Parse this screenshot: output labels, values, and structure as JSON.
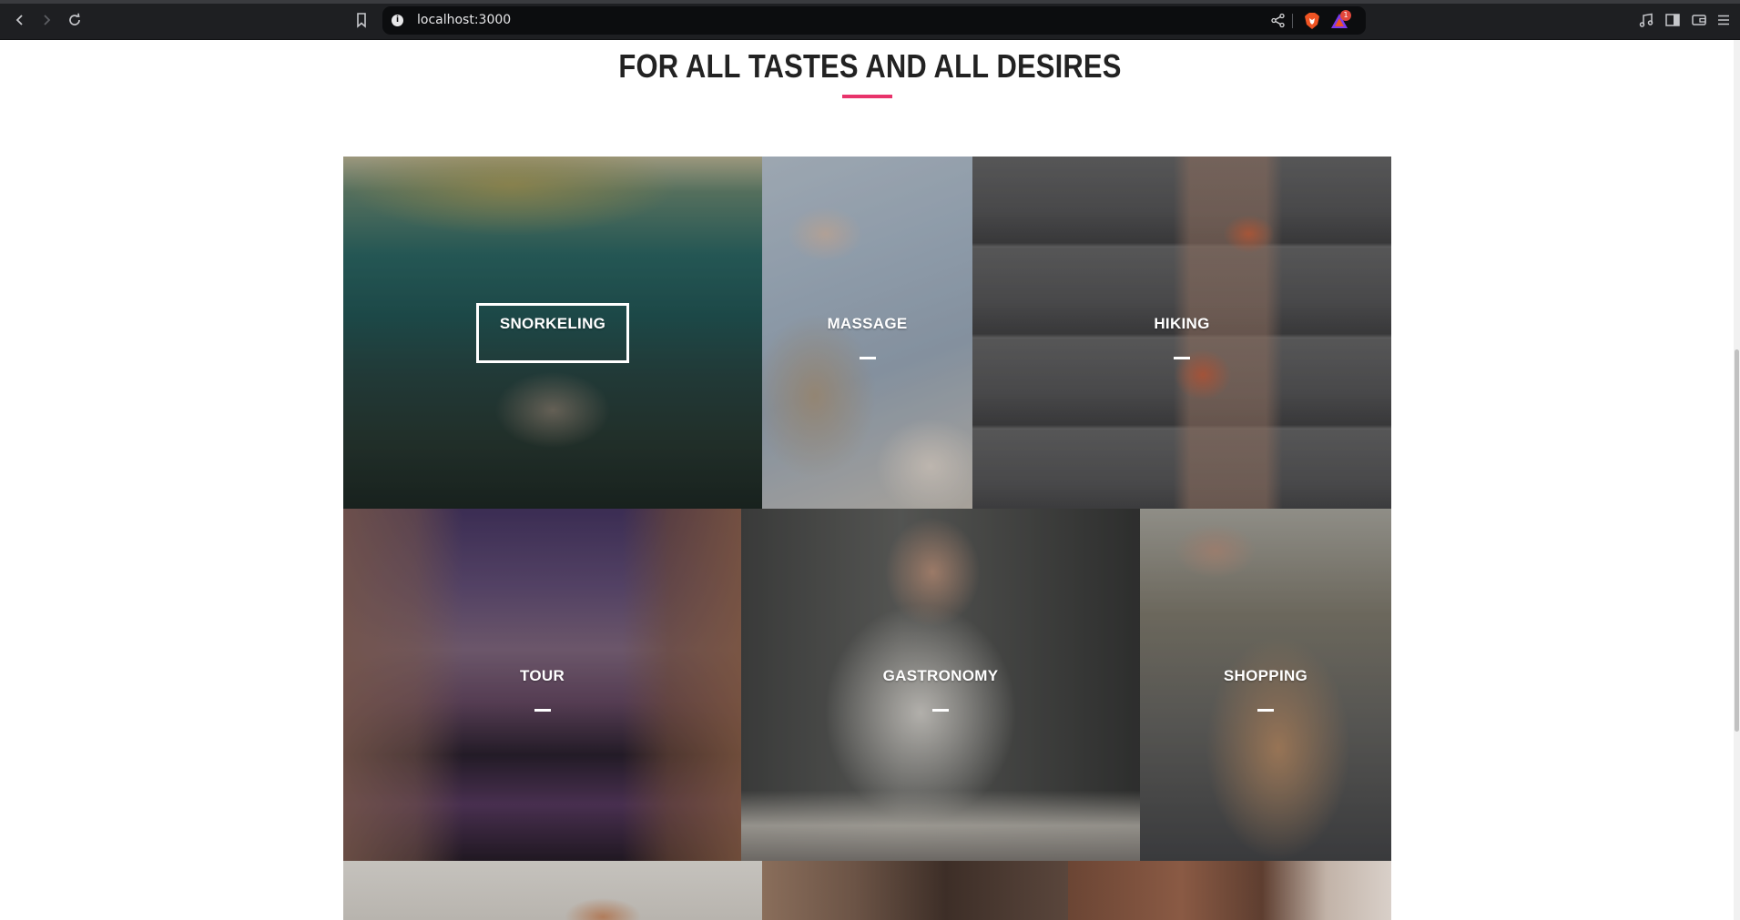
{
  "browser": {
    "url": "localhost:3000",
    "rewards_badge": "1"
  },
  "section": {
    "title": "FOR ALL TASTES AND ALL DESIRES",
    "accent_color": "#e8336b"
  },
  "activities": [
    {
      "label": "SNORKELING",
      "state": "hovered"
    },
    {
      "label": "MASSAGE"
    },
    {
      "label": "HIKING"
    },
    {
      "label": "TOUR"
    },
    {
      "label": "GASTRONOMY"
    },
    {
      "label": "SHOPPING"
    }
  ]
}
